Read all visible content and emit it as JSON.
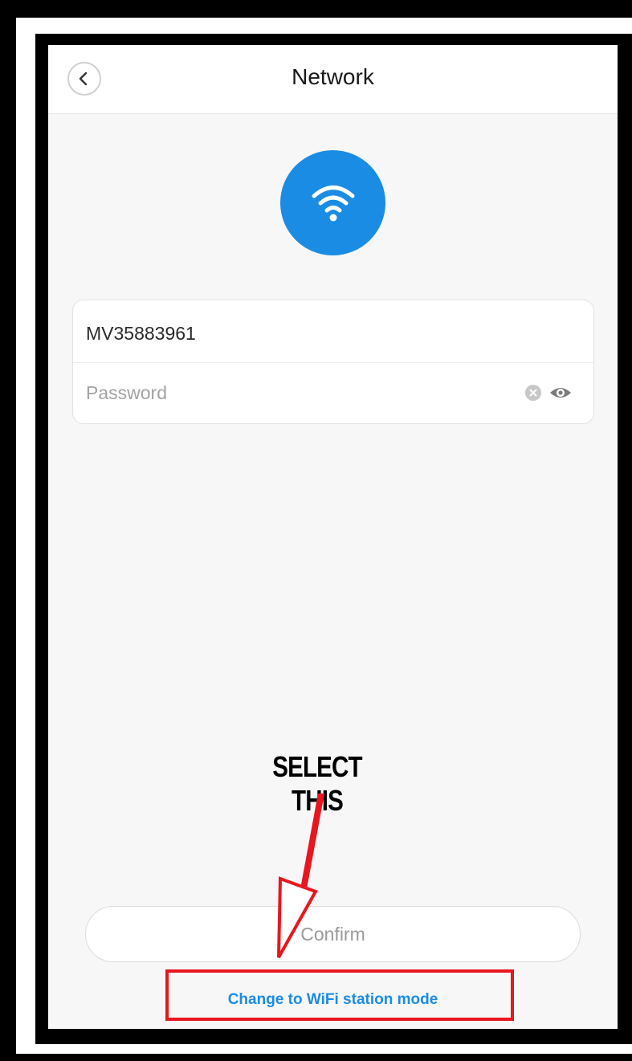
{
  "header": {
    "title": "Network"
  },
  "network": {
    "ssid": "MV35883961",
    "password_placeholder": "Password"
  },
  "actions": {
    "confirm_label": "Confirm",
    "station_mode_label": "Change to WiFi station mode"
  },
  "annotation": {
    "text": "SELECT THIS",
    "color": "#e8161e"
  },
  "colors": {
    "accent": "#1b8ce3",
    "background": "#f7f7f7"
  },
  "icons": {
    "back": "chevron-left-icon",
    "wifi": "wifi-icon",
    "clear": "clear-icon",
    "visibility": "eye-icon"
  }
}
